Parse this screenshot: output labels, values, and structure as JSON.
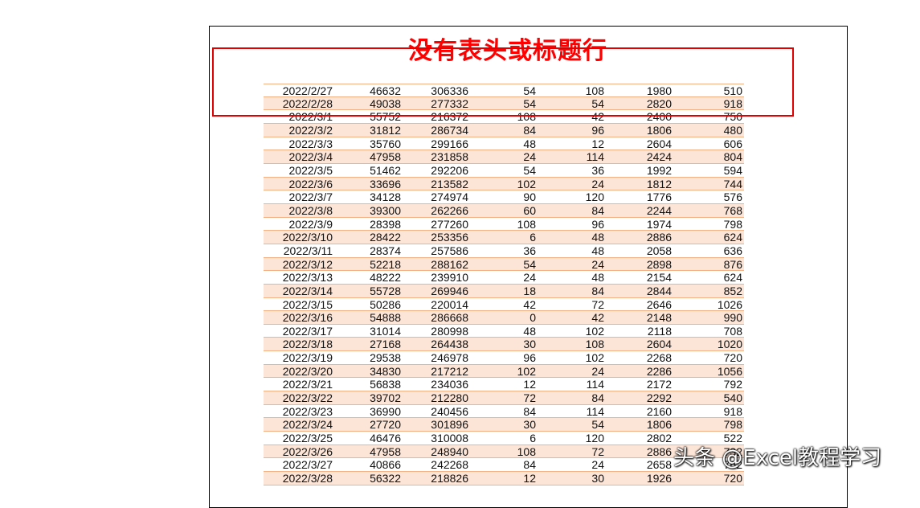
{
  "sheet_title": "没有表头或标题行",
  "watermark": "头条 @Excel教程学习",
  "colors": {
    "title": "#ff0000",
    "highlight_box": "#e00000",
    "row_band": "#fce4d6",
    "border": "#f4b183"
  },
  "rows": [
    [
      "2022/2/27",
      "46632",
      "306336",
      "54",
      "108",
      "1980",
      "510"
    ],
    [
      "2022/2/28",
      "49038",
      "277332",
      "54",
      "54",
      "2820",
      "918"
    ],
    [
      "2022/3/1",
      "55752",
      "216372",
      "108",
      "42",
      "2400",
      "750"
    ],
    [
      "2022/3/2",
      "31812",
      "286734",
      "84",
      "96",
      "1806",
      "480"
    ],
    [
      "2022/3/3",
      "35760",
      "299166",
      "48",
      "12",
      "2604",
      "606"
    ],
    [
      "2022/3/4",
      "47958",
      "231858",
      "24",
      "114",
      "2424",
      "804"
    ],
    [
      "2022/3/5",
      "51462",
      "292206",
      "54",
      "36",
      "1992",
      "594"
    ],
    [
      "2022/3/6",
      "33696",
      "213582",
      "102",
      "24",
      "1812",
      "744"
    ],
    [
      "2022/3/7",
      "34128",
      "274974",
      "90",
      "120",
      "1776",
      "576"
    ],
    [
      "2022/3/8",
      "39300",
      "262266",
      "60",
      "84",
      "2244",
      "768"
    ],
    [
      "2022/3/9",
      "28398",
      "277260",
      "108",
      "96",
      "1974",
      "798"
    ],
    [
      "2022/3/10",
      "28422",
      "253356",
      "6",
      "48",
      "2886",
      "624"
    ],
    [
      "2022/3/11",
      "28374",
      "257586",
      "36",
      "48",
      "2058",
      "636"
    ],
    [
      "2022/3/12",
      "52218",
      "288162",
      "54",
      "24",
      "2898",
      "876"
    ],
    [
      "2022/3/13",
      "48222",
      "239910",
      "24",
      "48",
      "2154",
      "624"
    ],
    [
      "2022/3/14",
      "55728",
      "269946",
      "18",
      "84",
      "2844",
      "852"
    ],
    [
      "2022/3/15",
      "50286",
      "220014",
      "42",
      "72",
      "2646",
      "1026"
    ],
    [
      "2022/3/16",
      "54888",
      "286668",
      "0",
      "42",
      "2148",
      "990"
    ],
    [
      "2022/3/17",
      "31014",
      "280998",
      "48",
      "102",
      "2118",
      "708"
    ],
    [
      "2022/3/18",
      "27168",
      "264438",
      "30",
      "108",
      "2604",
      "1020"
    ],
    [
      "2022/3/19",
      "29538",
      "246978",
      "96",
      "102",
      "2268",
      "720"
    ],
    [
      "2022/3/20",
      "34830",
      "217212",
      "102",
      "24",
      "2286",
      "1056"
    ],
    [
      "2022/3/21",
      "56838",
      "234036",
      "12",
      "114",
      "2172",
      "792"
    ],
    [
      "2022/3/22",
      "39702",
      "212280",
      "72",
      "84",
      "2292",
      "540"
    ],
    [
      "2022/3/23",
      "36990",
      "240456",
      "84",
      "114",
      "2160",
      "918"
    ],
    [
      "2022/3/24",
      "27720",
      "301896",
      "30",
      "54",
      "1806",
      "798"
    ],
    [
      "2022/3/25",
      "46476",
      "310008",
      "6",
      "120",
      "2802",
      "522"
    ],
    [
      "2022/3/26",
      "47958",
      "248940",
      "108",
      "72",
      "2886",
      "732"
    ],
    [
      "2022/3/27",
      "40866",
      "242268",
      "84",
      "24",
      "2658",
      "762"
    ],
    [
      "2022/3/28",
      "56322",
      "218826",
      "12",
      "30",
      "1926",
      "720"
    ]
  ]
}
